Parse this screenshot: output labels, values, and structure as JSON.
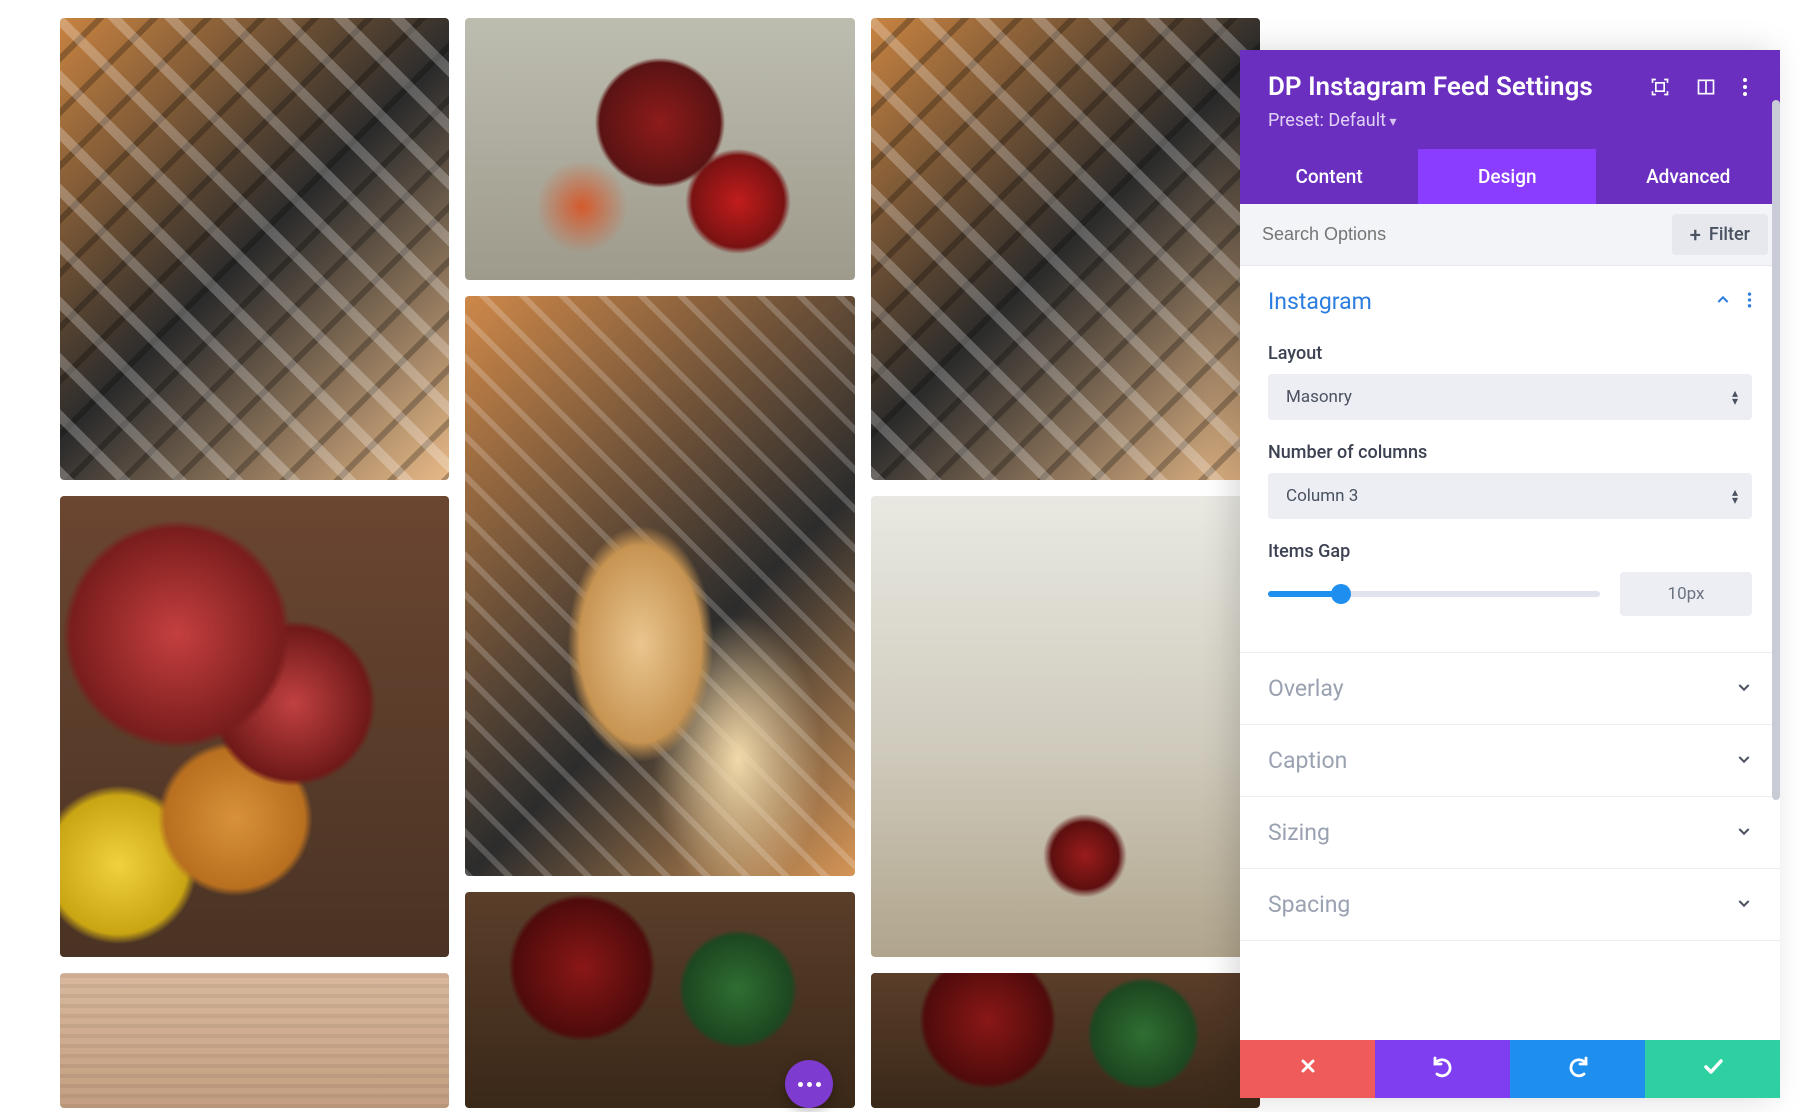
{
  "panel": {
    "title": "DP Instagram Feed Settings",
    "preset_label": "Preset: Default",
    "tabs": [
      "Content",
      "Design",
      "Advanced"
    ],
    "active_tab": "Design",
    "search_placeholder": "Search Options",
    "filter_button": "Filter"
  },
  "sections": {
    "instagram": {
      "title": "Instagram",
      "layout_label": "Layout",
      "layout_value": "Masonry",
      "columns_label": "Number of columns",
      "columns_value": "Column 3",
      "gap_label": "Items Gap",
      "gap_value": "10px"
    },
    "overlay": {
      "title": "Overlay"
    },
    "caption": {
      "title": "Caption"
    },
    "sizing": {
      "title": "Sizing"
    },
    "spacing": {
      "title": "Spacing"
    }
  },
  "actions": {
    "cancel": "Cancel",
    "undo": "Undo",
    "redo": "Redo",
    "save": "Save"
  }
}
